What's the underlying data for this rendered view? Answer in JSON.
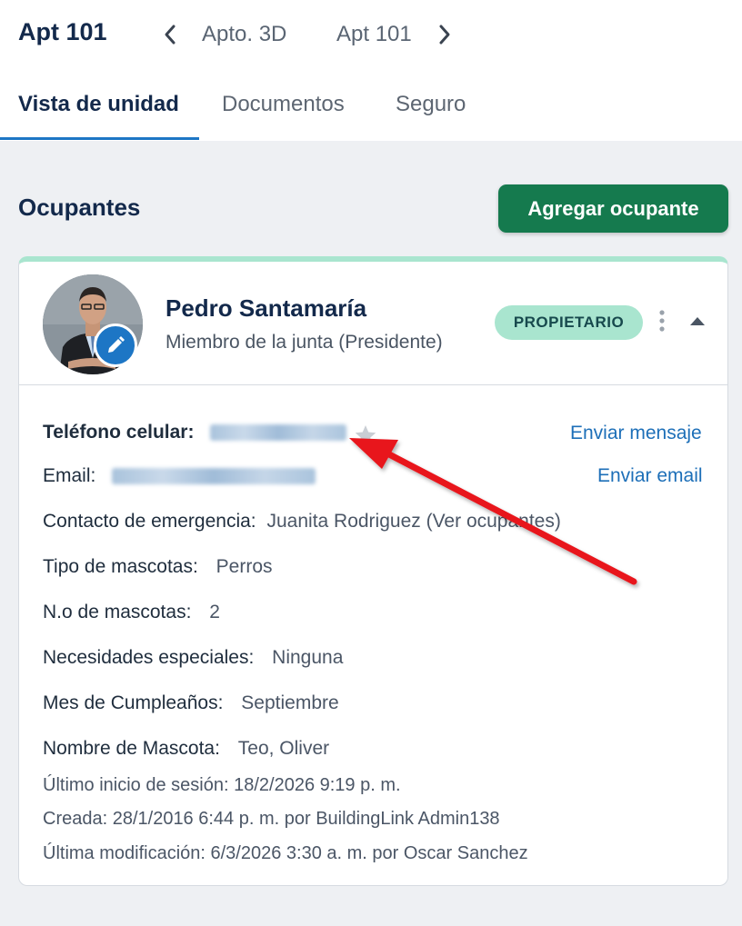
{
  "header": {
    "title": "Apt 101",
    "nav_prev_label": "Apto. 3D",
    "nav_next_label": "Apt 101"
  },
  "tabs": [
    {
      "label": "Vista de unidad",
      "active": true
    },
    {
      "label": "Documentos",
      "active": false
    },
    {
      "label": "Seguro",
      "active": false
    }
  ],
  "section": {
    "title": "Ocupantes",
    "add_button": "Agregar ocupante"
  },
  "occupant": {
    "name": "Pedro Santamaría",
    "role": "Miembro de la junta (Presidente)",
    "badge": "PROPIETARIO",
    "phone_label": "Teléfono celular:",
    "send_message": "Enviar mensaje",
    "email_label": "Email:",
    "send_email": "Enviar email",
    "emergency_label": "Contacto de emergencia:",
    "emergency_value": "Juanita Rodriguez (Ver ocupantes)",
    "pet_type_label": "Tipo de mascotas:",
    "pet_type_value": "Perros",
    "pet_count_label": "N.o de mascotas:",
    "pet_count_value": "2",
    "special_needs_label": "Necesidades especiales:",
    "special_needs_value": "Ninguna",
    "birthday_label": "Mes de Cumpleaños:",
    "birthday_value": "Septiembre",
    "pet_name_label": "Nombre de Mascota:",
    "pet_name_value": "Teo, Oliver",
    "last_login": "Último inicio de sesión:  18/2/2026 9:19 p. m.",
    "created": "Creada:  28/1/2016 6:44 p. m. por BuildingLink Admin138",
    "modified": "Última modificación:  6/3/2026 3:30 a. m. por Oscar Sanchez"
  },
  "colors": {
    "primary_blue": "#1d76c5",
    "add_green": "#157a4e",
    "badge_mint": "#a9e5cf",
    "annotation_red": "#e8121a"
  },
  "icons": [
    "chevron-left-icon",
    "chevron-right-icon",
    "pencil-icon",
    "kebab-icon",
    "chevron-up-icon",
    "star-icon"
  ]
}
